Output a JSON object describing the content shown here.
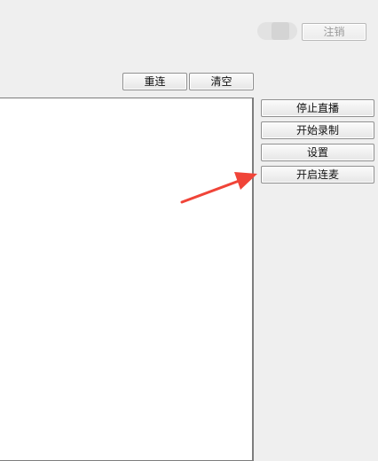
{
  "header": {
    "toggle_icon": "toggle-switch",
    "logout_label": "注销"
  },
  "log_toolbar": {
    "reconnect_label": "重连",
    "clear_label": "清空"
  },
  "log_panel": {
    "content": ""
  },
  "side_buttons": {
    "stop_live_label": "停止直播",
    "start_recording_label": "开始录制",
    "settings_label": "设置",
    "start_co_host_label": "开启连麦"
  },
  "annotation": {
    "arrow_color": "#f04438"
  }
}
